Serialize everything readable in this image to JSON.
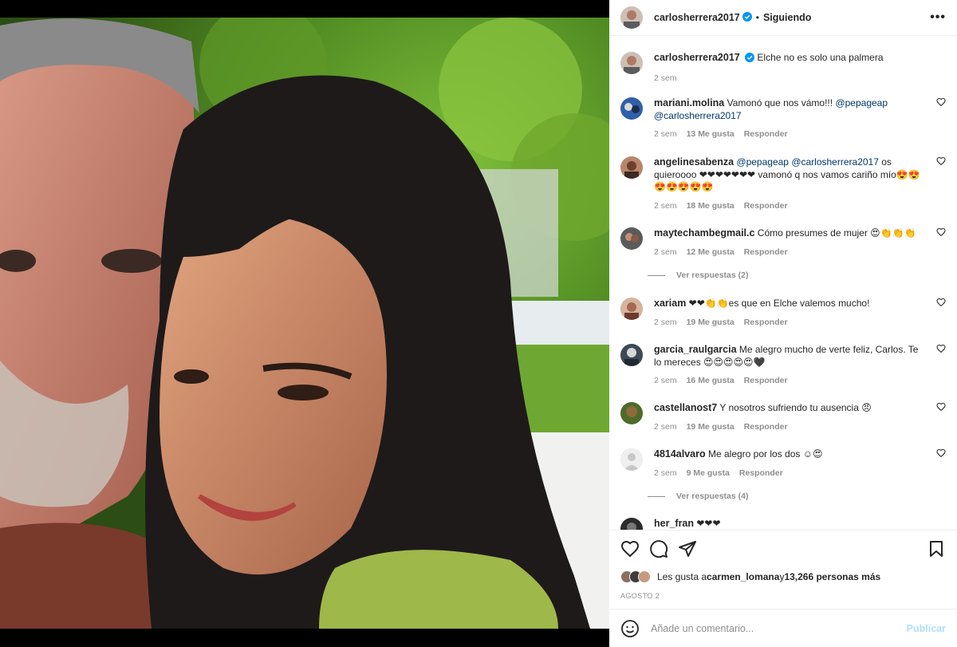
{
  "post": {
    "author": "carlosherrera2017",
    "separator": "•",
    "follow_label": "Siguiendo",
    "more_label": "•••",
    "caption": "Elche no es solo una palmera",
    "caption_time": "2 sem"
  },
  "comments": [
    {
      "user": "mariani.molina",
      "text": "Vamonó que nos vámo!!! ",
      "mention1": "@pepageap",
      "mention2": "@carlosherrera2017",
      "time": "2 sem",
      "likes": "13 Me gusta",
      "reply": "Responder"
    },
    {
      "user": "angelinesabenza",
      "text_before": "",
      "mention1": "@pepageap",
      "mention2": "@carlosherrera2017",
      "text": " os quieroooo ❤❤❤❤❤❤❤ vamonó q nos vamos cariño mío😍😍😍😍😍😍😍",
      "time": "2 sem",
      "likes": "18 Me gusta",
      "reply": "Responder"
    },
    {
      "user": "maytechambegmail.c",
      "text": "Cómo presumes de mujer 😍👏👏👏",
      "time": "2 sem",
      "likes": "12 Me gusta",
      "reply": "Responder",
      "view_replies": "Ver respuestas (2)"
    },
    {
      "user": "xariam",
      "text": "❤❤👏👏es que en Elche valemos mucho!",
      "time": "2 sem",
      "likes": "19 Me gusta",
      "reply": "Responder"
    },
    {
      "user": "garcia_raulgarcia",
      "text": "Me alegro mucho de verte feliz, Carlos. Te lo mereces 😍😍😍😍😍🖤",
      "time": "2 sem",
      "likes": "16 Me gusta",
      "reply": "Responder"
    },
    {
      "user": "castellanost7",
      "text": "Y nosotros sufriendo tu ausencia 😠",
      "time": "2 sem",
      "likes": "19 Me gusta",
      "reply": "Responder"
    },
    {
      "user": "4814alvaro",
      "text": "Me alegro por los dos ☺😍",
      "time": "2 sem",
      "likes": "9 Me gusta",
      "reply": "Responder",
      "view_replies": "Ver respuestas (4)"
    },
    {
      "user": "her_fran",
      "text": "❤❤❤"
    }
  ],
  "likes": {
    "prefix": "Les gusta a ",
    "user": "carmen_lomana",
    "middle": " y ",
    "count": "13,266 personas más"
  },
  "date": "AGOSTO 2",
  "add_comment": {
    "placeholder": "Añade un comentario...",
    "publish_label": "Publicar"
  },
  "icons": {
    "like": "heart-icon",
    "comment": "comment-icon",
    "share": "share-icon",
    "save": "bookmark-icon",
    "emoji": "emoji-icon",
    "verified": "verified-icon",
    "more": "more-icon"
  },
  "colors": {
    "mention": "#00376b",
    "verified": "#0095f6",
    "publish_disabled": "#b2dffc",
    "meta": "#8e8e8e"
  }
}
